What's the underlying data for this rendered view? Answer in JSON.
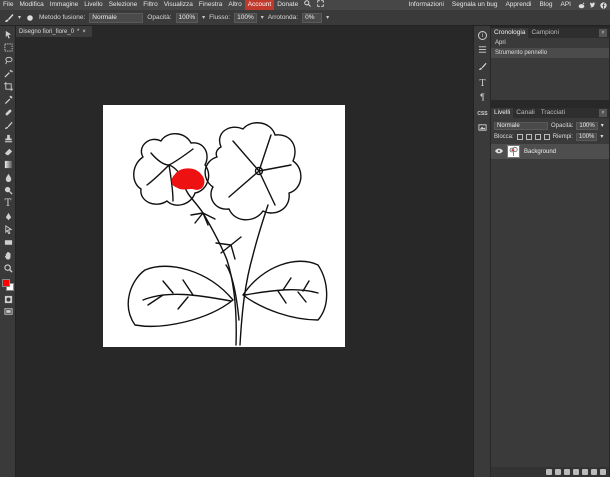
{
  "menubar": {
    "items": [
      "File",
      "Modifica",
      "Immagine",
      "Livello",
      "Selezione",
      "Filtro",
      "Visualizza",
      "Finestra",
      "Altro"
    ],
    "account": "Account",
    "donate": "Donate",
    "right_items": [
      "Informazioni",
      "Segnala un bug",
      "Apprendi",
      "Blog",
      "API"
    ],
    "accent_color": "#c0392b"
  },
  "options": {
    "blend_label": "Metodo fusione:",
    "blend_value": "Normale",
    "opacity_label": "Opacità:",
    "opacity_value": "100%",
    "flow_label": "Flusso:",
    "flow_value": "100%",
    "smooth_label": "Arrotonda:",
    "smooth_value": "0%"
  },
  "document": {
    "tab_label": "Disegno fiori_fiore_0",
    "tab_marker": "*",
    "tab_close": "×"
  },
  "history": {
    "tabs": [
      "Cronologia",
      "Campioni"
    ],
    "items": [
      "Apri",
      "Strumento pennello"
    ]
  },
  "layers": {
    "tabs": [
      "Livelli",
      "Canali",
      "Tracciati"
    ],
    "blend_value": "Normale",
    "opacity_label": "Opacità:",
    "opacity_value": "100%",
    "lock_label": "Blocca:",
    "fill_label": "Riempi:",
    "fill_value": "100%",
    "layer_name": "Background"
  },
  "panel_buttons": {
    "css_label": "CSS"
  },
  "colors": {
    "foreground": "#ff0000",
    "background": "#ffffff",
    "paint": "#ee1111"
  }
}
